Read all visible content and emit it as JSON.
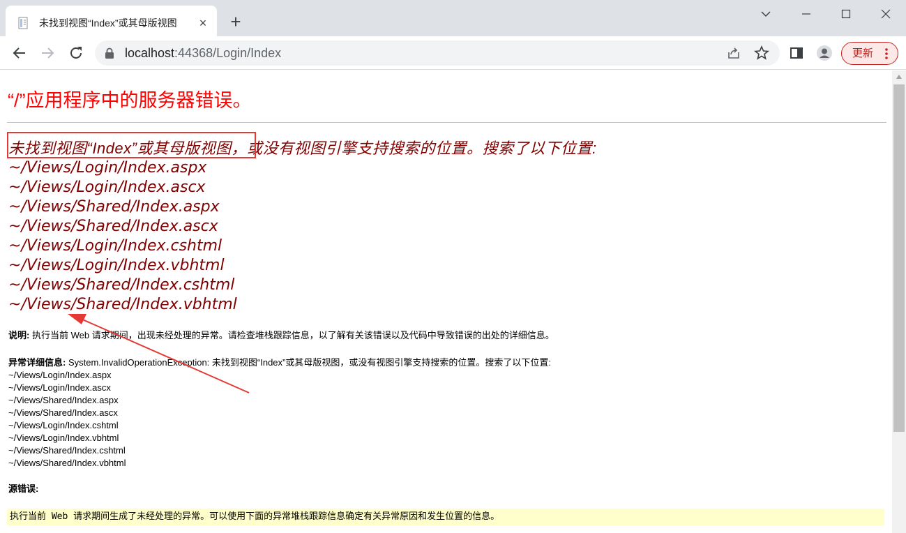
{
  "browser": {
    "tab_title": "未找到视图“Index”或其母版视图",
    "new_tab": "+",
    "close": "×",
    "url_host": "localhost",
    "url_rest": ":44368/Login/Index",
    "update_label": "更新"
  },
  "page": {
    "title": "“/”应用程序中的服务器错误。",
    "error_heading_highlight": "未找到视图“Index”或其母版视图，",
    "error_heading_rest": "或没有视图引擎支持搜索的位置。搜索了以下位置:",
    "locations": [
      "~/Views/Login/Index.aspx",
      "~/Views/Login/Index.ascx",
      "~/Views/Shared/Index.aspx",
      "~/Views/Shared/Index.ascx",
      "~/Views/Login/Index.cshtml",
      "~/Views/Login/Index.vbhtml",
      "~/Views/Shared/Index.cshtml",
      "~/Views/Shared/Index.vbhtml"
    ],
    "description_label": "说明:",
    "description_text": "执行当前 Web 请求期间，出现未经处理的异常。请检查堆栈跟踪信息，以了解有关该错误以及代码中导致错误的出处的详细信息。",
    "exception_label": "异常详细信息:",
    "exception_text": "System.InvalidOperationException: 未找到视图“Index”或其母版视图，或没有视图引擎支持搜索的位置。搜索了以下位置:",
    "source_error_label": "源错误:",
    "source_error_text": "执行当前 Web 请求期间生成了未经处理的异常。可以使用下面的异常堆栈跟踪信息确定有关异常原因和发生位置的信息。"
  },
  "colors": {
    "title_red": "#ff0000",
    "heading_maroon": "#800000",
    "annotation_red": "#e53935",
    "code_bg": "#ffffcc"
  },
  "icons": [
    "page-favicon-icon",
    "close-icon",
    "plus-icon",
    "chevron-down-icon",
    "minimize-icon",
    "maximize-icon",
    "window-close-icon",
    "back-arrow-icon",
    "forward-arrow-icon",
    "reload-icon",
    "lock-icon",
    "share-icon",
    "star-icon",
    "side-panel-icon",
    "profile-icon",
    "more-vert-icon"
  ]
}
